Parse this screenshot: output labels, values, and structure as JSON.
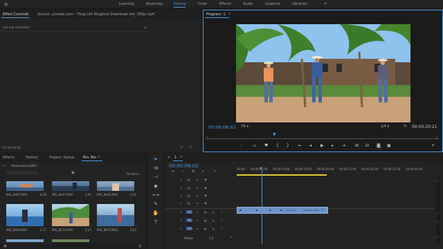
{
  "workspaces": [
    "Learning",
    "Assembly",
    "Editing",
    "Color",
    "Effects",
    "Audio",
    "Graphics",
    "Libraries"
  ],
  "active_workspace": "Editing",
  "more_glyph": "»",
  "source_panel": {
    "tab_effect_controls": "Effect Controls",
    "tab_source": "Source: y2mate.com - Thug Life Ringtone  Download link_360p.mp4",
    "no_clip": "(no clip selected)",
    "timecode": "00:00:06:02"
  },
  "program": {
    "title": "Program: 1",
    "timecode": "00:00:06:02",
    "fit": "Fit",
    "ratio": "1/4",
    "duration": "00:00:20:21"
  },
  "project": {
    "tabs": [
      "Effects",
      "History",
      "Project: Уроки",
      "Bin: Bin"
    ],
    "active_tab": "Bin: Bin",
    "path": "Уроки.prproj\\Bin",
    "items_count": "78 Items",
    "clips": [
      {
        "name": "IMG_8487.MOV",
        "duration": "6;28"
      },
      {
        "name": "IMG_8647.MOV",
        "duration": "2;01"
      },
      {
        "name": "IMG_8645.MOV",
        "duration": "2;01"
      },
      {
        "name": "IMG_8646.MOV",
        "duration": "2;17"
      },
      {
        "name": "IMG_8672.MOV",
        "duration": "5;17"
      },
      {
        "name": "IMG_8673.MOV",
        "duration": "2;03"
      }
    ]
  },
  "timeline": {
    "timecode": "00:00:06:02",
    "ruler": [
      "00:00",
      "00:00:05:00",
      "00:00:10:00",
      "00:00:15:00",
      "00:00:20:00",
      "00:00:25:00",
      "00:00:30:00",
      "00:00:35:00",
      "00:00:40:00"
    ],
    "video_tracks": [
      "V4",
      "V3",
      "V2",
      "V1"
    ],
    "audio_tracks": [
      "A1",
      "A2",
      "A3"
    ],
    "master_label": "Master",
    "master_value": "0.0",
    "clip_v1_label": "y2mate.com - Th",
    "clip_v1_small": "12l_007"
  },
  "colors": {
    "accent": "#4d9ee8",
    "clip": "#6b93c7",
    "bg": "#1d1d1d"
  },
  "icons": {
    "home": "home-icon",
    "play": "play-icon",
    "wrench": "wrench-icon"
  }
}
